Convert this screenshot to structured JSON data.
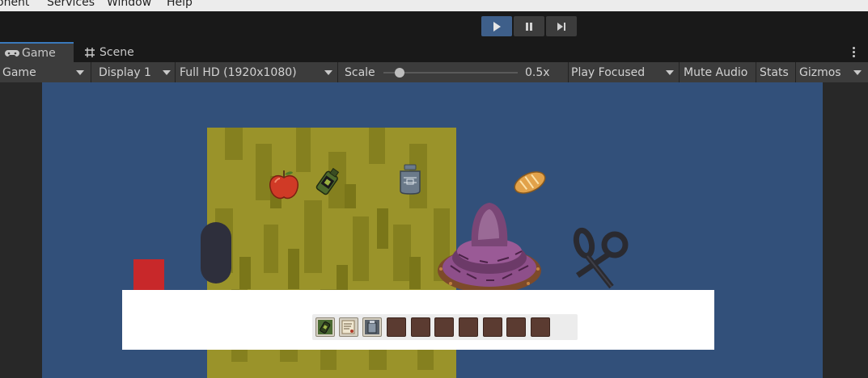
{
  "menu": {
    "items": [
      "onent",
      "Services",
      "Window",
      "Help"
    ]
  },
  "play_controls": {
    "play_icon": "play-icon",
    "pause_icon": "pause-icon",
    "step_icon": "step-icon",
    "play_active": true
  },
  "tabs": [
    {
      "label": "Game",
      "icon": "gamepad-icon",
      "active": true
    },
    {
      "label": "Scene",
      "icon": "grid-hash-icon",
      "active": false
    }
  ],
  "toolbar": {
    "view_mode": "Game",
    "display": "Display 1",
    "resolution": "Full HD (1920x1080)",
    "scale_label": "Scale",
    "scale_value": "0.5x",
    "scale_fraction": 0.12,
    "play_mode": "Play Focused",
    "mute_audio": "Mute Audio",
    "stats": "Stats",
    "gizmos": "Gizmos"
  },
  "colors": {
    "editor_bg": "#191919",
    "toolbar_bg": "#3c3c3c",
    "accent_blue": "#3e5f8a",
    "game_bg": "#32507a",
    "grass": "#9a932a",
    "red_block": "#c8282a",
    "capsule": "#2e2f3c"
  },
  "scene": {
    "world_items": [
      "apple-icon",
      "bottle-icon",
      "jar-icon",
      "bread-icon",
      "thorn-nest-icon",
      "scissors-icon",
      "capsule-object",
      "red-block-object"
    ]
  },
  "inventory": {
    "slot_count": 10,
    "filled_slots": [
      "bottle-icon",
      "scroll-icon",
      "jar-icon"
    ]
  }
}
